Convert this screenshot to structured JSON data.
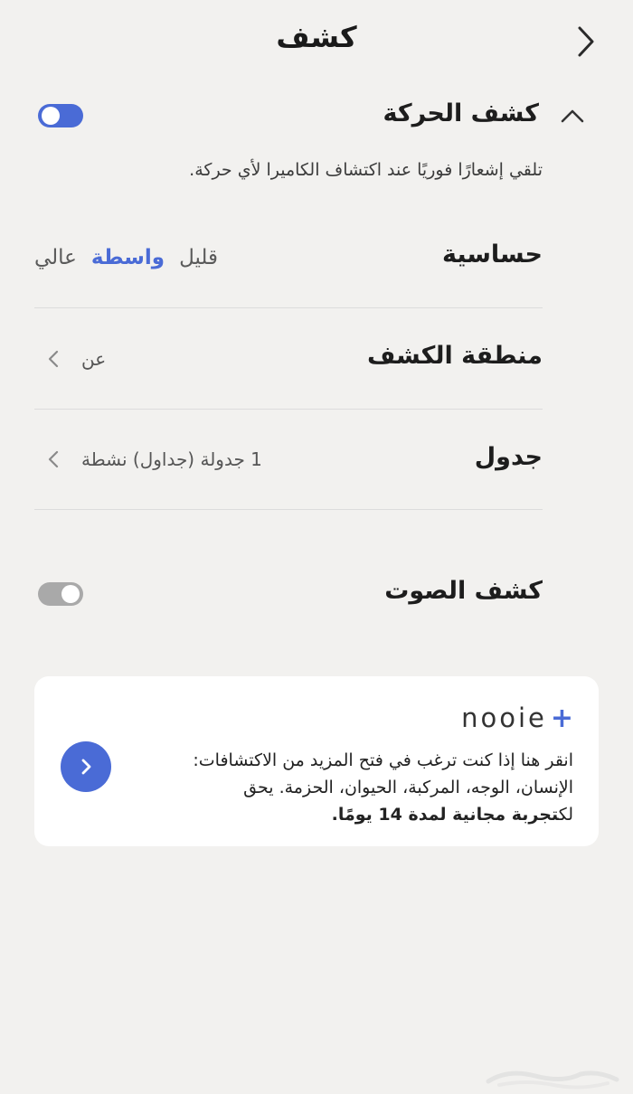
{
  "header": {
    "title": "كشف"
  },
  "motion": {
    "title": "كشف الحركة",
    "toggle_on": true,
    "description": "تلقي إشعارًا فوريًا عند اكتشاف الكاميرا لأي حركة."
  },
  "sensitivity": {
    "title": "حساسية",
    "options": [
      "قليل",
      "واسطة",
      "عالي"
    ],
    "selected": "واسطة"
  },
  "detection_zone": {
    "title": "منطقة الكشف",
    "value": "عن"
  },
  "schedule": {
    "title": "جدول",
    "value": "1 جدولة (جداول) نشطة"
  },
  "sound": {
    "title": "كشف الصوت",
    "toggle_on": false
  },
  "promo": {
    "brand": "nooie",
    "brand_plus": "+",
    "line1": "انقر هنا إذا كنت ترغب في فتح المزيد من الاكتشافات:",
    "line2": "الإنسان، الوجه، المركبة، الحيوان، الحزمة. يحق",
    "line3_normal": "لك",
    "line3_bold": "تجربة مجانية لمدة 14 يومًا."
  },
  "colors": {
    "accent": "#4a6bd6",
    "background": "#f2f1ef",
    "toggle_off": "#a9a9a9",
    "card": "#ffffff"
  },
  "icons": {
    "back": "chevron-right-icon",
    "collapse": "chevron-up-icon",
    "row_arrow": "chevron-left-icon",
    "promo_go": "chevron-right-icon"
  }
}
